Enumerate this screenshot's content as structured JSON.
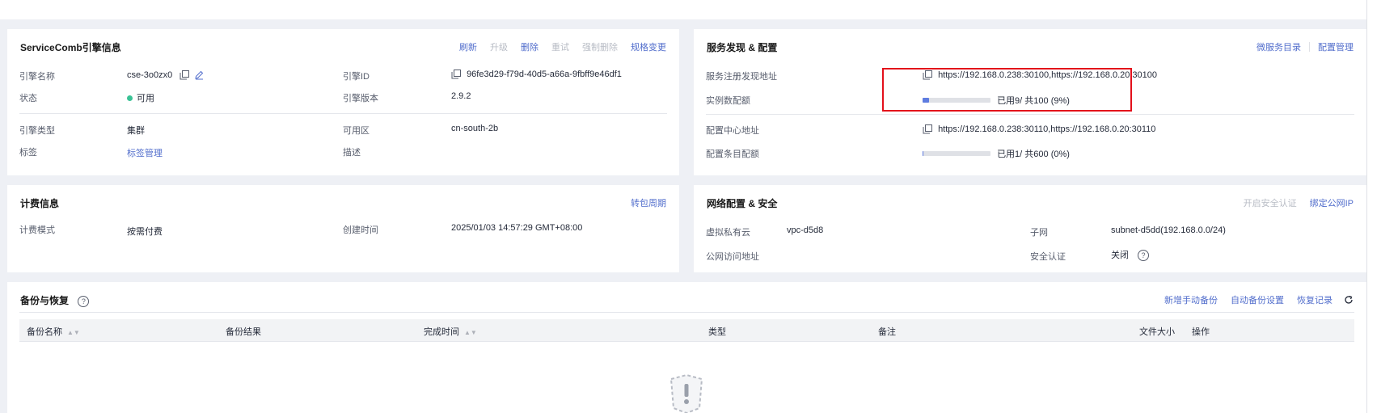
{
  "engine": {
    "title": "ServiceComb引擎信息",
    "actions": [
      {
        "label": "刷新",
        "enabled": true
      },
      {
        "label": "升级",
        "enabled": false
      },
      {
        "label": "删除",
        "enabled": true
      },
      {
        "label": "重试",
        "enabled": false
      },
      {
        "label": "强制删除",
        "enabled": false
      },
      {
        "label": "规格变更",
        "enabled": true
      }
    ],
    "name_label": "引擎名称",
    "name_value": "cse-3o0zx0",
    "status_label": "状态",
    "status_value": "可用",
    "id_label": "引擎ID",
    "id_value": "96fe3d29-f79d-40d5-a66a-9fbff9e46df1",
    "version_label": "引擎版本",
    "version_value": "2.9.2",
    "type_label": "引擎类型",
    "type_value": "集群",
    "az_label": "可用区",
    "az_value": "cn-south-2b",
    "tags_label": "标签",
    "tags_value": "标签管理",
    "desc_label": "描述",
    "desc_value": ""
  },
  "discovery": {
    "title": "服务发现 & 配置",
    "actions": [
      "微服务目录",
      "配置管理"
    ],
    "reg_label": "服务注册发现地址",
    "reg_value": "https://192.168.0.238:30100,https://192.168.0.20:30100",
    "instance_quota_label": "实例数配额",
    "instance_quota_text": "已用9/ 共100 (9%)",
    "instance_quota_fraction": 0.09,
    "config_addr_label": "配置中心地址",
    "config_addr_value": "https://192.168.0.238:30110,https://192.168.0.20:30110",
    "config_quota_label": "配置条目配额",
    "config_quota_text": "已用1/ 共600 (0%)",
    "config_quota_fraction": 0.0017
  },
  "billing": {
    "title": "计费信息",
    "action": "转包周期",
    "mode_label": "计费模式",
    "mode_value": "按需付费",
    "created_label": "创建时间",
    "created_value": "2025/01/03 14:57:29 GMT+08:00"
  },
  "network": {
    "title": "网络配置 & 安全",
    "actions": [
      {
        "label": "开启安全认证",
        "enabled": false
      },
      {
        "label": "绑定公网IP",
        "enabled": true
      }
    ],
    "vpc_label": "虚拟私有云",
    "vpc_value": "vpc-d5d8",
    "subnet_label": "子网",
    "subnet_value": "subnet-d5dd(192.168.0.0/24)",
    "public_label": "公网访问地址",
    "public_value": "",
    "auth_label": "安全认证",
    "auth_value": "关闭"
  },
  "backup": {
    "title": "备份与恢复",
    "actions": [
      "新增手动备份",
      "自动备份设置",
      "恢复记录"
    ],
    "columns": [
      "备份名称",
      "备份结果",
      "完成时间",
      "类型",
      "备注",
      "文件大小",
      "操作"
    ]
  },
  "colors": {
    "accent": "#526ecc",
    "success": "#3ac295",
    "highlight": "#e3101b",
    "progress": "#5e7ce0"
  }
}
